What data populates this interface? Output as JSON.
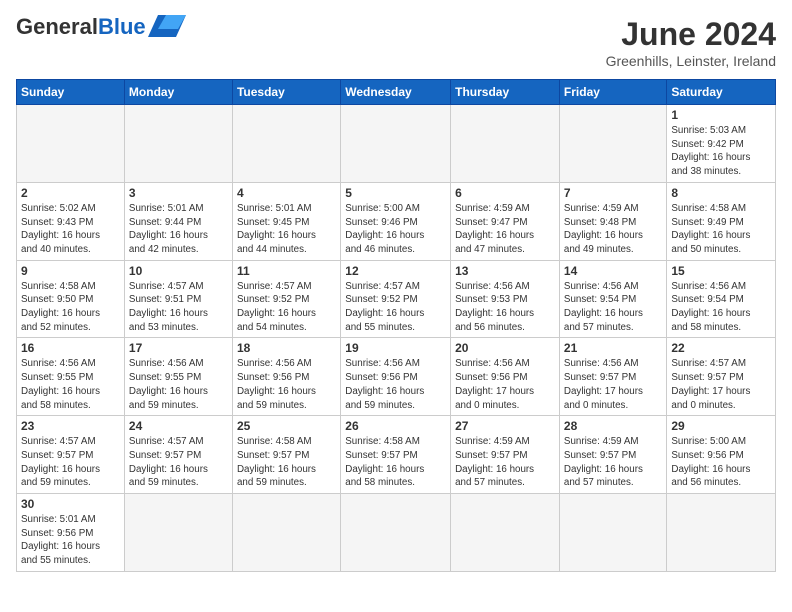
{
  "header": {
    "logo_general": "General",
    "logo_blue": "Blue",
    "month_title": "June 2024",
    "subtitle": "Greenhills, Leinster, Ireland"
  },
  "days_of_week": [
    "Sunday",
    "Monday",
    "Tuesday",
    "Wednesday",
    "Thursday",
    "Friday",
    "Saturday"
  ],
  "weeks": [
    {
      "days": [
        {
          "number": "",
          "info": ""
        },
        {
          "number": "",
          "info": ""
        },
        {
          "number": "",
          "info": ""
        },
        {
          "number": "",
          "info": ""
        },
        {
          "number": "",
          "info": ""
        },
        {
          "number": "",
          "info": ""
        },
        {
          "number": "1",
          "info": "Sunrise: 5:03 AM\nSunset: 9:42 PM\nDaylight: 16 hours\nand 38 minutes."
        }
      ]
    },
    {
      "days": [
        {
          "number": "2",
          "info": "Sunrise: 5:02 AM\nSunset: 9:43 PM\nDaylight: 16 hours\nand 40 minutes."
        },
        {
          "number": "3",
          "info": "Sunrise: 5:01 AM\nSunset: 9:44 PM\nDaylight: 16 hours\nand 42 minutes."
        },
        {
          "number": "4",
          "info": "Sunrise: 5:01 AM\nSunset: 9:45 PM\nDaylight: 16 hours\nand 44 minutes."
        },
        {
          "number": "5",
          "info": "Sunrise: 5:00 AM\nSunset: 9:46 PM\nDaylight: 16 hours\nand 46 minutes."
        },
        {
          "number": "6",
          "info": "Sunrise: 4:59 AM\nSunset: 9:47 PM\nDaylight: 16 hours\nand 47 minutes."
        },
        {
          "number": "7",
          "info": "Sunrise: 4:59 AM\nSunset: 9:48 PM\nDaylight: 16 hours\nand 49 minutes."
        },
        {
          "number": "8",
          "info": "Sunrise: 4:58 AM\nSunset: 9:49 PM\nDaylight: 16 hours\nand 50 minutes."
        }
      ]
    },
    {
      "days": [
        {
          "number": "9",
          "info": "Sunrise: 4:58 AM\nSunset: 9:50 PM\nDaylight: 16 hours\nand 52 minutes."
        },
        {
          "number": "10",
          "info": "Sunrise: 4:57 AM\nSunset: 9:51 PM\nDaylight: 16 hours\nand 53 minutes."
        },
        {
          "number": "11",
          "info": "Sunrise: 4:57 AM\nSunset: 9:52 PM\nDaylight: 16 hours\nand 54 minutes."
        },
        {
          "number": "12",
          "info": "Sunrise: 4:57 AM\nSunset: 9:52 PM\nDaylight: 16 hours\nand 55 minutes."
        },
        {
          "number": "13",
          "info": "Sunrise: 4:56 AM\nSunset: 9:53 PM\nDaylight: 16 hours\nand 56 minutes."
        },
        {
          "number": "14",
          "info": "Sunrise: 4:56 AM\nSunset: 9:54 PM\nDaylight: 16 hours\nand 57 minutes."
        },
        {
          "number": "15",
          "info": "Sunrise: 4:56 AM\nSunset: 9:54 PM\nDaylight: 16 hours\nand 58 minutes."
        }
      ]
    },
    {
      "days": [
        {
          "number": "16",
          "info": "Sunrise: 4:56 AM\nSunset: 9:55 PM\nDaylight: 16 hours\nand 58 minutes."
        },
        {
          "number": "17",
          "info": "Sunrise: 4:56 AM\nSunset: 9:55 PM\nDaylight: 16 hours\nand 59 minutes."
        },
        {
          "number": "18",
          "info": "Sunrise: 4:56 AM\nSunset: 9:56 PM\nDaylight: 16 hours\nand 59 minutes."
        },
        {
          "number": "19",
          "info": "Sunrise: 4:56 AM\nSunset: 9:56 PM\nDaylight: 16 hours\nand 59 minutes."
        },
        {
          "number": "20",
          "info": "Sunrise: 4:56 AM\nSunset: 9:56 PM\nDaylight: 17 hours\nand 0 minutes."
        },
        {
          "number": "21",
          "info": "Sunrise: 4:56 AM\nSunset: 9:57 PM\nDaylight: 17 hours\nand 0 minutes."
        },
        {
          "number": "22",
          "info": "Sunrise: 4:57 AM\nSunset: 9:57 PM\nDaylight: 17 hours\nand 0 minutes."
        }
      ]
    },
    {
      "days": [
        {
          "number": "23",
          "info": "Sunrise: 4:57 AM\nSunset: 9:57 PM\nDaylight: 16 hours\nand 59 minutes."
        },
        {
          "number": "24",
          "info": "Sunrise: 4:57 AM\nSunset: 9:57 PM\nDaylight: 16 hours\nand 59 minutes."
        },
        {
          "number": "25",
          "info": "Sunrise: 4:58 AM\nSunset: 9:57 PM\nDaylight: 16 hours\nand 59 minutes."
        },
        {
          "number": "26",
          "info": "Sunrise: 4:58 AM\nSunset: 9:57 PM\nDaylight: 16 hours\nand 58 minutes."
        },
        {
          "number": "27",
          "info": "Sunrise: 4:59 AM\nSunset: 9:57 PM\nDaylight: 16 hours\nand 57 minutes."
        },
        {
          "number": "28",
          "info": "Sunrise: 4:59 AM\nSunset: 9:57 PM\nDaylight: 16 hours\nand 57 minutes."
        },
        {
          "number": "29",
          "info": "Sunrise: 5:00 AM\nSunset: 9:56 PM\nDaylight: 16 hours\nand 56 minutes."
        }
      ]
    },
    {
      "days": [
        {
          "number": "30",
          "info": "Sunrise: 5:01 AM\nSunset: 9:56 PM\nDaylight: 16 hours\nand 55 minutes."
        },
        {
          "number": "",
          "info": ""
        },
        {
          "number": "",
          "info": ""
        },
        {
          "number": "",
          "info": ""
        },
        {
          "number": "",
          "info": ""
        },
        {
          "number": "",
          "info": ""
        },
        {
          "number": "",
          "info": ""
        }
      ]
    }
  ]
}
